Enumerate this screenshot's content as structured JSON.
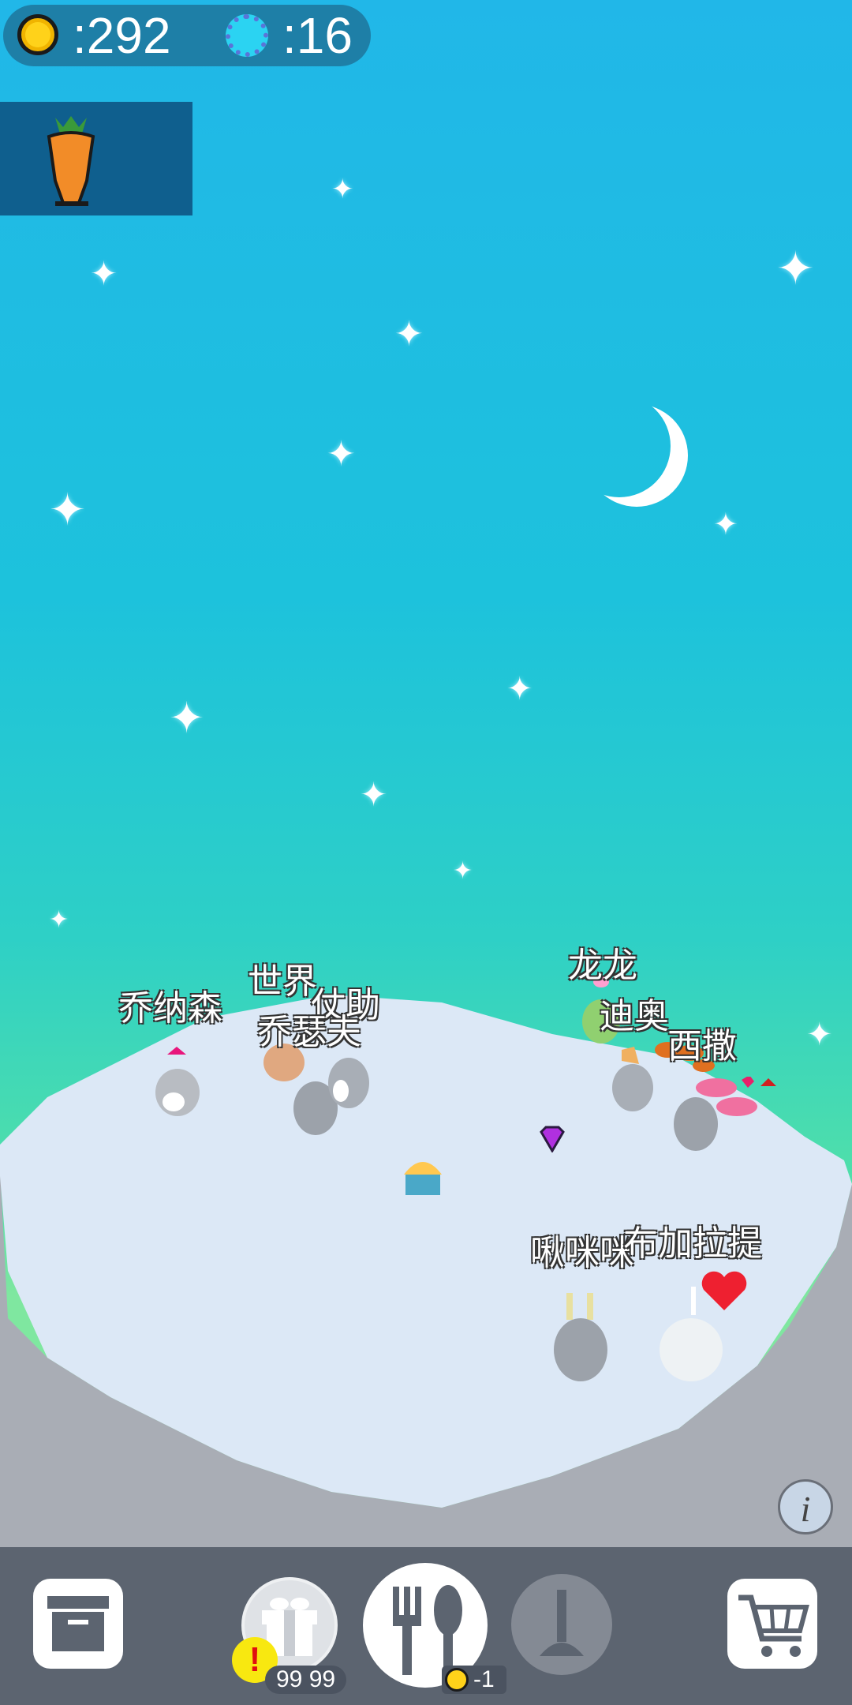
{
  "hud": {
    "coin_icon": "gold-coin-icon",
    "coins": ":292",
    "gem_icon": "blue-gem-icon",
    "gems": ":16"
  },
  "selected_item": {
    "icon": "carrot-icon"
  },
  "bunnies": [
    {
      "name": "乔纳森"
    },
    {
      "name": "世界"
    },
    {
      "name": "仗助"
    },
    {
      "name": "乔瑟夫"
    },
    {
      "name": "龙龙"
    },
    {
      "name": "迪奥"
    },
    {
      "name": "西撒"
    },
    {
      "name": "啾咪咪"
    },
    {
      "name": "布加拉提"
    }
  ],
  "toolbar": {
    "storage_icon": "storage-box-icon",
    "gift_icon": "gift-icon",
    "gift_count": "99 99",
    "gift_alert": "!",
    "feed_icon": "fork-spoon-icon",
    "feed_cost": "-1",
    "clean_icon": "plunger-icon",
    "shop_icon": "shopping-cart-icon"
  },
  "info_button": "i",
  "colors": {
    "sky_top": "#21b7e8",
    "sky_bottom": "#7fe7a0",
    "hud_bg": "#1e7fa7",
    "toolbar_bg": "#5c6470"
  }
}
